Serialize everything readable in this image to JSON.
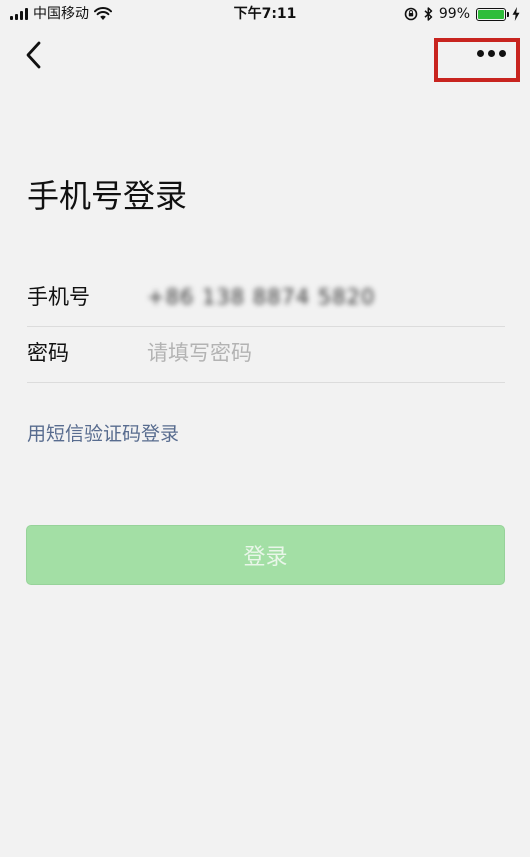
{
  "status_bar": {
    "carrier": "中国移动",
    "time": "下午7:11",
    "battery_percent": "99%",
    "battery_level": 0.99
  },
  "nav": {
    "back_icon": "chevron-left-icon",
    "more_icon": "more-horizontal-icon"
  },
  "title": "手机号登录",
  "form": {
    "phone": {
      "label": "手机号",
      "value": "+86 138 8874 5820"
    },
    "password": {
      "label": "密码",
      "placeholder": "请填写密码"
    }
  },
  "sms_login_link": "用短信验证码登录",
  "login_button_label": "登录",
  "colors": {
    "background": "#f2f2f2",
    "highlight_border": "#c8241f",
    "link": "#586c8f",
    "button_disabled": "#a3dfa5",
    "battery": "#2fbd3a"
  }
}
